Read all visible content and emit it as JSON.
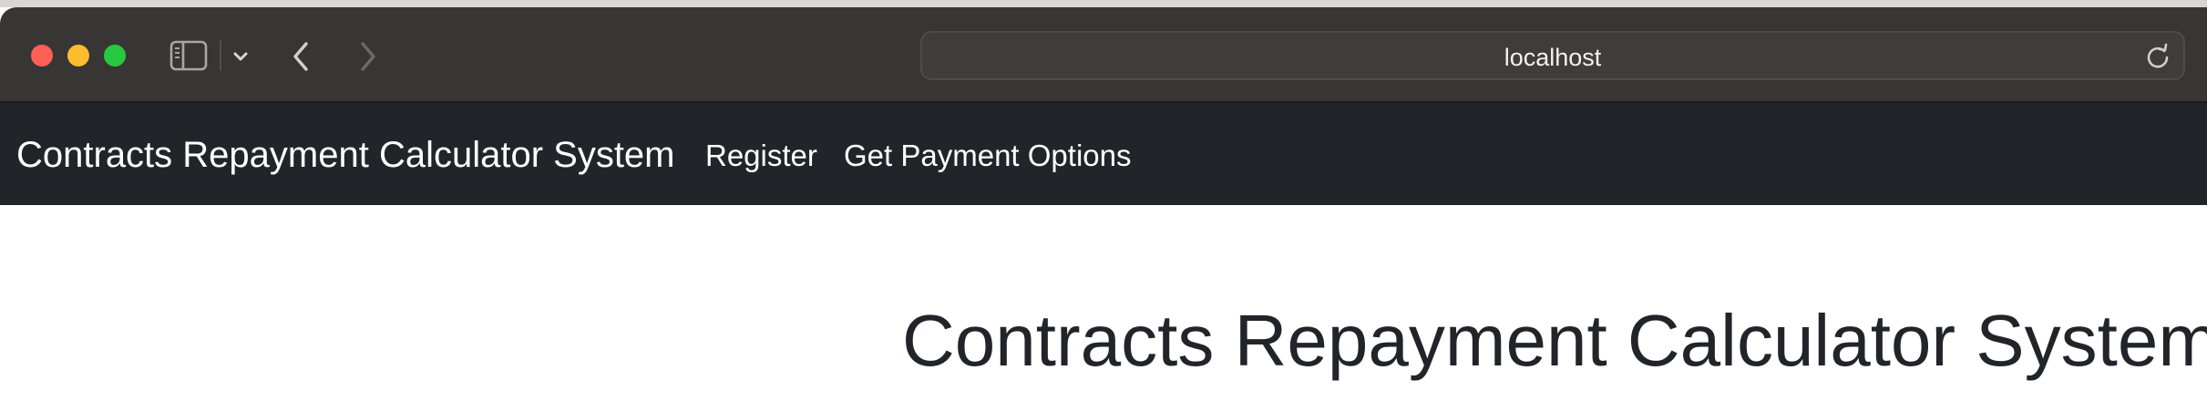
{
  "browser": {
    "url": "localhost",
    "icons": {
      "sidebar": "sidebar-icon",
      "chevron": "chevron-down-icon",
      "back": "back-arrow-icon",
      "forward": "forward-arrow-icon",
      "reload": "reload-icon"
    },
    "colors": {
      "close": "#fe5f57",
      "minimize": "#febc2e",
      "zoom": "#28c840",
      "titlebar": "#373634"
    }
  },
  "navbar": {
    "brand": "Contracts Repayment Calculator System",
    "links": [
      {
        "label": "Register"
      },
      {
        "label": "Get Payment Options"
      }
    ],
    "background": "#212529"
  },
  "main": {
    "title": "Contracts Repayment Calculator System"
  }
}
